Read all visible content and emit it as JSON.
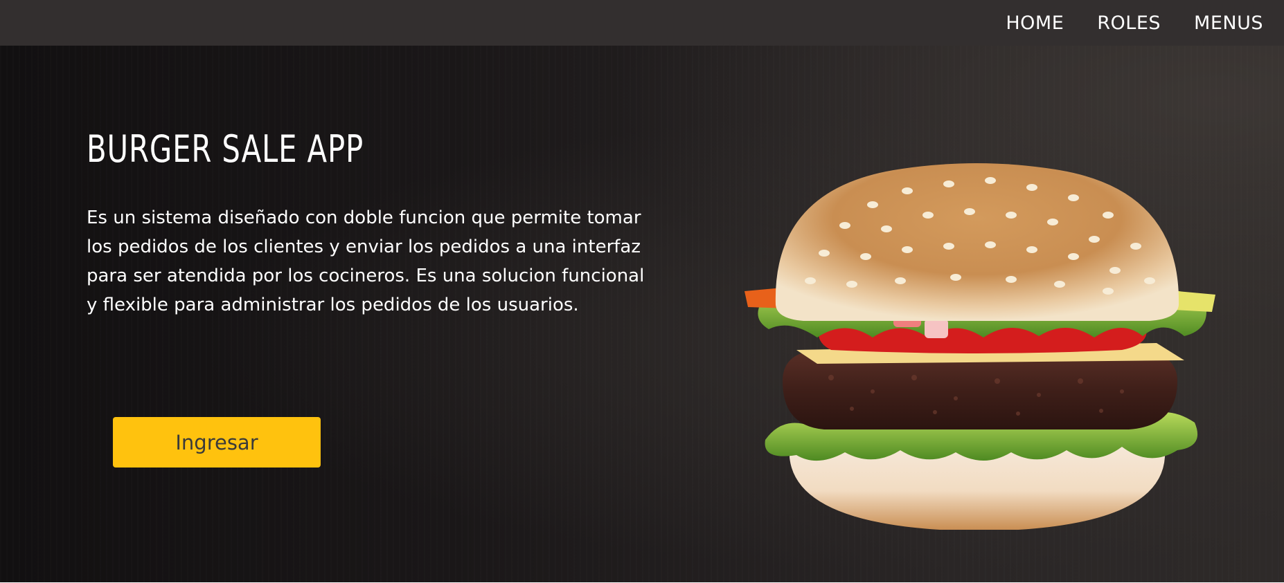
{
  "nav": {
    "items": [
      {
        "label": "HOME"
      },
      {
        "label": "ROLES"
      },
      {
        "label": "MENUS"
      }
    ]
  },
  "hero": {
    "title": "BURGER SALE APP",
    "description": "Es un sistema diseñado con doble funcion que permite tomar los pedidos de los clientes y enviar los pedidos a una interfaz para ser atendida por los cocineros. Es una solucion funcional y flexible para administrar los pedidos de los usuarios.",
    "cta_label": "Ingresar",
    "image_icon": "burger-image"
  },
  "colors": {
    "navbar": "#332f2f",
    "accent": "#ffc20e",
    "hero_background": "#1a1718",
    "text": "#ffffff"
  }
}
